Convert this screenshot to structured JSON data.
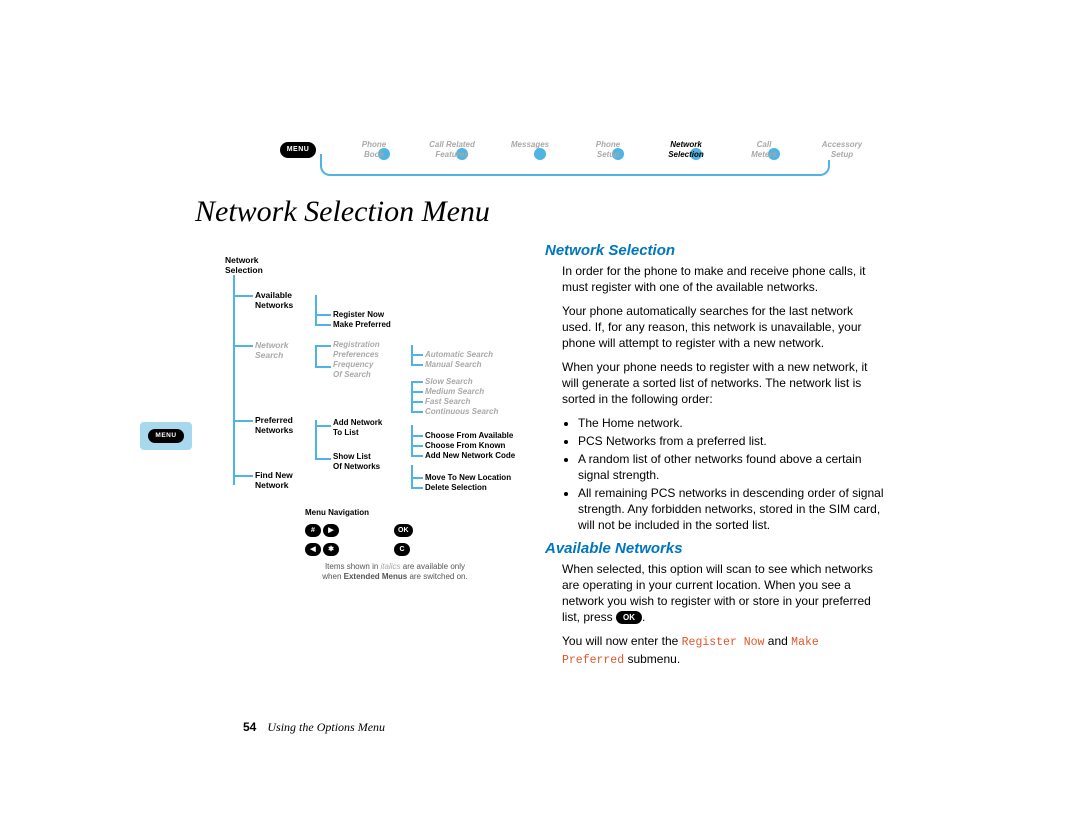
{
  "top_menu": {
    "chip": "MENU",
    "items": [
      {
        "l1": "Phone",
        "l2": "Book",
        "active": false
      },
      {
        "l1": "Call Related",
        "l2": "Features",
        "active": false
      },
      {
        "l1": "Messages",
        "l2": "",
        "active": false
      },
      {
        "l1": "Phone",
        "l2": "Setup",
        "active": false
      },
      {
        "l1": "Network",
        "l2": "Selection",
        "active": true
      },
      {
        "l1": "Call",
        "l2": "Meters",
        "active": false
      },
      {
        "l1": "Accessory",
        "l2": "Setup",
        "active": false
      }
    ]
  },
  "page_title": "Network Selection Menu",
  "left_badge": "MENU",
  "tree": {
    "root_l1": "Network",
    "root_l2": "Selection",
    "lvl2a_l1": "Available",
    "lvl2a_l2": "Networks",
    "lvl2b_l1": "Network",
    "lvl2b_l2": "Search",
    "lvl2c_l1": "Preferred",
    "lvl2c_l2": "Networks",
    "lvl2d_l1": "Find New",
    "lvl2d_l2": "Network",
    "lvl3a1": "Register Now",
    "lvl3a2": "Make Preferred",
    "lvl3b1_l1": "Registration",
    "lvl3b1_l2": "Preferences",
    "lvl3b2_l1": "Frequency",
    "lvl3b2_l2": "Of Search",
    "lvl3c1_l1": "Add Network",
    "lvl3c1_l2": "To List",
    "lvl3c2_l1": "Show List",
    "lvl3c2_l2": "Of Networks",
    "lvl4ba1": "Automatic Search",
    "lvl4ba2": "Manual Search",
    "lvl4bb1": "Slow Search",
    "lvl4bb2": "Medium Search",
    "lvl4bb3": "Fast Search",
    "lvl4bb4": "Continuous Search",
    "lvl4cc1": "Choose From Available",
    "lvl4cc2": "Choose From Known",
    "lvl4cc3": "Add New Network Code",
    "lvl4dd1": "Move To New Location",
    "lvl4dd2": "Delete Selection"
  },
  "legend": {
    "title": "Menu Navigation",
    "pound": "#",
    "right": "▶",
    "star": "✱",
    "left": "◀",
    "ok": "OK",
    "c": "C",
    "note_pre": "Items shown in ",
    "note_it": "italics",
    "note_mid": " are available only",
    "note_post_pre": "when ",
    "note_post_b": "Extended Menus",
    "note_post_end": " are switched on."
  },
  "body": {
    "s1_title": "Network Selection",
    "s1_p1": "In order for the phone to make and receive phone calls, it must register with one of the available networks.",
    "s1_p2": "Your phone automatically searches for the last network used. If, for any reason, this network is unavailable, your phone will attempt to register with a new network.",
    "s1_p3": "When your phone needs to register with a new network, it will generate a sorted list of networks. The network list is sorted in the following order:",
    "s1_li1": "The Home network.",
    "s1_li2": "PCS Networks from a preferred list.",
    "s1_li3": "A random list of other networks found above a certain signal strength.",
    "s1_li4": "All remaining PCS networks in descending order of signal strength. Any forbidden networks, stored in the SIM card, will not be included in the sorted list.",
    "s2_title": "Available Networks",
    "s2_p1a": "When selected, this option will scan to see which networks are operating in your current location. When you see a network you wish to register with or store in your preferred list, press ",
    "s2_ok": "OK",
    "s2_p1b": ".",
    "s2_p2a": "You will now enter the ",
    "s2_mono1": "Register Now",
    "s2_and": " and ",
    "s2_mono2": "Make Preferred",
    "s2_p2b": " submenu."
  },
  "footer": {
    "page": "54",
    "section": "Using the Options Menu"
  }
}
